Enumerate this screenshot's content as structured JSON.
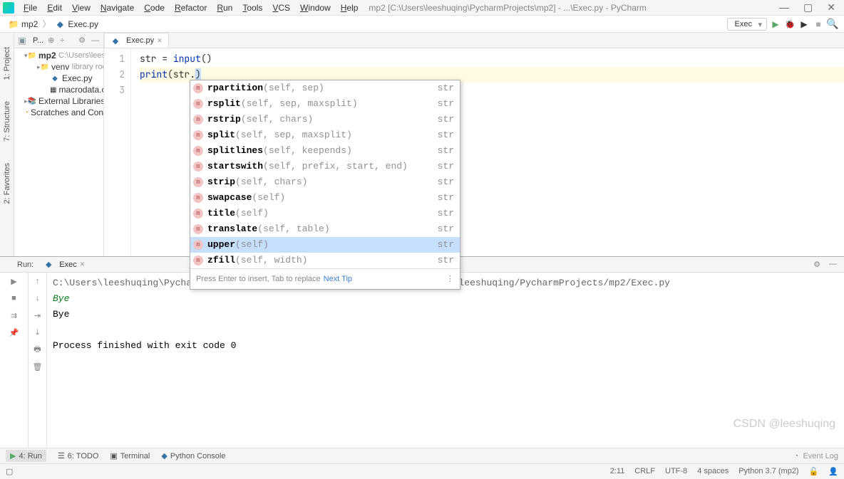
{
  "window": {
    "menus": [
      "File",
      "Edit",
      "View",
      "Navigate",
      "Code",
      "Refactor",
      "Run",
      "Tools",
      "VCS",
      "Window",
      "Help"
    ],
    "title_path": "mp2 [C:\\Users\\leeshuqing\\PycharmProjects\\mp2] - ...\\Exec.py - PyCharm"
  },
  "breadcrumb": {
    "project": "mp2",
    "file": "Exec.py"
  },
  "toolbar": {
    "config": "Exec"
  },
  "side_tabs": [
    "1: Project",
    "7: Structure",
    "2: Favorites"
  ],
  "project_panel": {
    "title": "P..."
  },
  "tree": {
    "root": "mp2",
    "root_path": "C:\\Users\\leeshu",
    "venv": "venv",
    "venv_hint": "library root",
    "exec": "Exec.py",
    "macro": "macrodata.csv",
    "ext": "External Libraries",
    "scratch": "Scratches and Consol"
  },
  "tab": {
    "name": "Exec.py"
  },
  "code": {
    "line1": {
      "pre": "str = ",
      "func": "input",
      "p1": "(",
      "p2": ")"
    },
    "line2": {
      "func": "print",
      "p1": "(",
      "arg": "str.",
      "p2": ")"
    }
  },
  "gutter": [
    "1",
    "2",
    "3"
  ],
  "autocomplete": {
    "items": [
      {
        "name": "rpartition",
        "params": "(self, sep)",
        "type": "str",
        "sel": false
      },
      {
        "name": "rsplit",
        "params": "(self, sep, maxsplit)",
        "type": "str",
        "sel": false
      },
      {
        "name": "rstrip",
        "params": "(self, chars)",
        "type": "str",
        "sel": false
      },
      {
        "name": "split",
        "params": "(self, sep, maxsplit)",
        "type": "str",
        "sel": false
      },
      {
        "name": "splitlines",
        "params": "(self, keepends)",
        "type": "str",
        "sel": false
      },
      {
        "name": "startswith",
        "params": "(self, prefix, start, end)",
        "type": "str",
        "sel": false
      },
      {
        "name": "strip",
        "params": "(self, chars)",
        "type": "str",
        "sel": false
      },
      {
        "name": "swapcase",
        "params": "(self)",
        "type": "str",
        "sel": false
      },
      {
        "name": "title",
        "params": "(self)",
        "type": "str",
        "sel": false
      },
      {
        "name": "translate",
        "params": "(self, table)",
        "type": "str",
        "sel": false
      },
      {
        "name": "upper",
        "params": "(self)",
        "type": "str",
        "sel": true
      },
      {
        "name": "zfill",
        "params": "(self, width)",
        "type": "str",
        "sel": false
      }
    ],
    "footer_hint": "Press Enter to insert, Tab to replace",
    "footer_next": "Next Tip"
  },
  "run_panel": {
    "label": "Run:",
    "tab_name": "Exec",
    "cmd": "C:\\Users\\leeshuqing\\PycharmProjects\\mp2\\venv\\Scripts\\python.exe C:/Users/leeshuqing/PycharmProjects/mp2/Exec.py",
    "input": "Bye",
    "output": "Bye",
    "exit": "Process finished with exit code 0"
  },
  "bottom_tabs": {
    "run": "4: Run",
    "todo": "6: TODO",
    "terminal": "Terminal",
    "pyconsole": "Python Console",
    "event_log": "Event Log"
  },
  "statusbar": {
    "pos": "2:11",
    "sep": "CRLF",
    "enc": "UTF-8",
    "indent": "4 spaces",
    "interp": "Python 3.7 (mp2)"
  },
  "watermark": "CSDN @leeshuqing"
}
